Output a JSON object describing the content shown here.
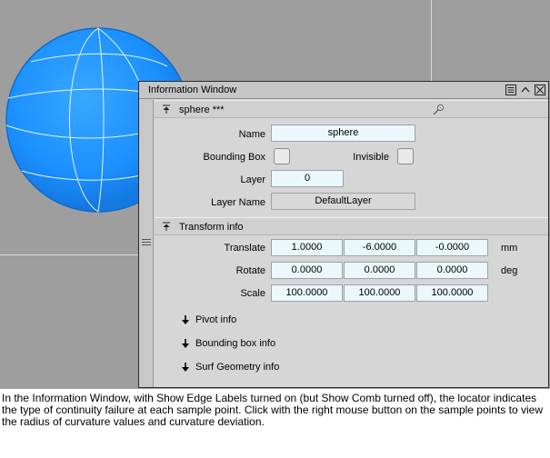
{
  "window": {
    "title": "Information Window"
  },
  "object": {
    "header": "sphere ***",
    "name_label": "Name",
    "name_value": "sphere",
    "bounding_box_label": "Bounding Box",
    "invisible_label": "Invisible",
    "layer_label": "Layer",
    "layer_value": "0",
    "layer_name_label": "Layer Name",
    "layer_name_value": "DefaultLayer"
  },
  "transform": {
    "header": "Transform info",
    "translate": {
      "label": "Translate",
      "values": [
        "1.0000",
        "-6.0000",
        "-0.0000"
      ],
      "unit": "mm"
    },
    "rotate": {
      "label": "Rotate",
      "values": [
        "0.0000",
        "0.0000",
        "0.0000"
      ],
      "unit": "deg"
    },
    "scale": {
      "label": "Scale",
      "values": [
        "100.0000",
        "100.0000",
        "100.0000"
      ],
      "unit": ""
    }
  },
  "collapsed_sections": [
    "Pivot info",
    "Bounding box info",
    "Surf Geometry info"
  ],
  "caption": "In the Information Window, with Show Edge Labels turned on (but Show Comb turned off), the locator indicates the type of continuity failure at each sample point. Click with the right mouse button on the sample points to view the radius of curvature values and curvature deviation.",
  "colors": {
    "viewport_bg": "#9e9e9e",
    "sphere": "#1e90ff",
    "field_bg": "#eaf8fb"
  },
  "icons": [
    "menu-icon",
    "collapse-icon",
    "close-icon",
    "pin-icon",
    "locator-icon",
    "arrow-down-icon",
    "drag-handle-icon"
  ]
}
